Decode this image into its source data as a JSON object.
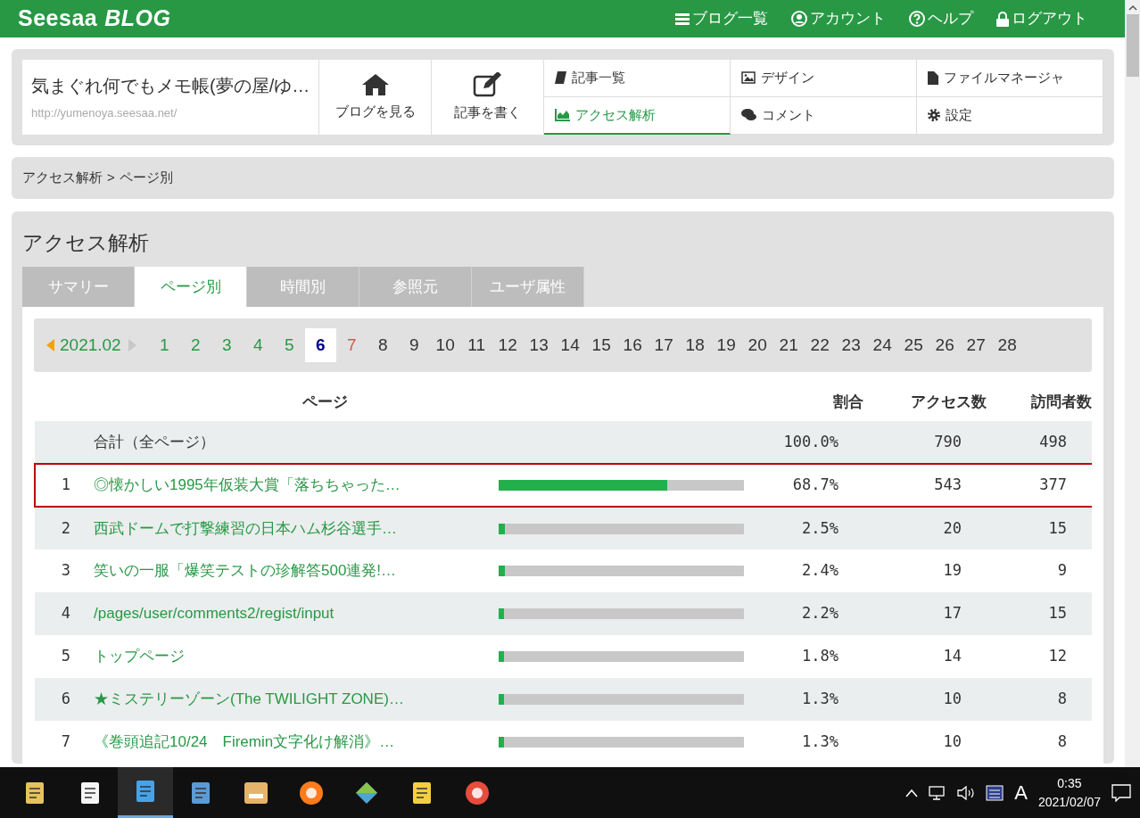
{
  "header": {
    "logo_text": "Seesaa",
    "logo_suffix": "BLOG",
    "menu": [
      {
        "label": "ブログ一覧"
      },
      {
        "label": "アカウント"
      },
      {
        "label": "ヘルプ"
      },
      {
        "label": "ログアウト"
      }
    ]
  },
  "blog": {
    "title": "気まぐれ何でもメモ帳(夢の屋/ゆ…",
    "url": "http://yumenoya.seesaa.net/"
  },
  "big_actions": [
    {
      "label": "ブログを見る"
    },
    {
      "label": "記事を書く"
    }
  ],
  "nav": [
    {
      "label": "記事一覧",
      "selected": false
    },
    {
      "label": "デザイン",
      "selected": false
    },
    {
      "label": "ファイルマネージャ",
      "selected": false
    },
    {
      "label": "アクセス解析",
      "selected": true
    },
    {
      "label": "コメント",
      "selected": false
    },
    {
      "label": "設定",
      "selected": false
    }
  ],
  "breadcrumb": [
    "アクセス解析",
    "ページ別"
  ],
  "breadcrumb_separator": ">",
  "section_title": "アクセス解析",
  "tabs": [
    {
      "label": "サマリー",
      "selected": false
    },
    {
      "label": "ページ別",
      "selected": true
    },
    {
      "label": "時間別",
      "selected": false
    },
    {
      "label": "参照元",
      "selected": false
    },
    {
      "label": "ユーザ属性",
      "selected": false
    }
  ],
  "month": "2021.02",
  "days": [
    {
      "label": "1",
      "kind": "past",
      "selected": false
    },
    {
      "label": "2",
      "kind": "past",
      "selected": false
    },
    {
      "label": "3",
      "kind": "past",
      "selected": false
    },
    {
      "label": "4",
      "kind": "past",
      "selected": false
    },
    {
      "label": "5",
      "kind": "past",
      "selected": false
    },
    {
      "label": "6",
      "kind": "past",
      "selected": true
    },
    {
      "label": "7",
      "kind": "holiday",
      "selected": false
    },
    {
      "label": "8",
      "kind": "future",
      "selected": false
    },
    {
      "label": "9",
      "kind": "future",
      "selected": false
    },
    {
      "label": "10",
      "kind": "future",
      "selected": false
    },
    {
      "label": "11",
      "kind": "future",
      "selected": false
    },
    {
      "label": "12",
      "kind": "future",
      "selected": false
    },
    {
      "label": "13",
      "kind": "future",
      "selected": false
    },
    {
      "label": "14",
      "kind": "future",
      "selected": false
    },
    {
      "label": "15",
      "kind": "future",
      "selected": false
    },
    {
      "label": "16",
      "kind": "future",
      "selected": false
    },
    {
      "label": "17",
      "kind": "future",
      "selected": false
    },
    {
      "label": "18",
      "kind": "future",
      "selected": false
    },
    {
      "label": "19",
      "kind": "future",
      "selected": false
    },
    {
      "label": "20",
      "kind": "future",
      "selected": false
    },
    {
      "label": "21",
      "kind": "future",
      "selected": false
    },
    {
      "label": "22",
      "kind": "future",
      "selected": false
    },
    {
      "label": "23",
      "kind": "future",
      "selected": false
    },
    {
      "label": "24",
      "kind": "future",
      "selected": false
    },
    {
      "label": "25",
      "kind": "future",
      "selected": false
    },
    {
      "label": "26",
      "kind": "future",
      "selected": false
    },
    {
      "label": "27",
      "kind": "future",
      "selected": false
    },
    {
      "label": "28",
      "kind": "future",
      "selected": false
    }
  ],
  "table": {
    "columns": [
      "ページ",
      "割合",
      "アクセス数",
      "訪問者数"
    ],
    "total": {
      "label": "合計（全ページ）",
      "share": "100.0%",
      "access": "790",
      "visitors": "498"
    },
    "rows": [
      {
        "rank": "1",
        "page": "◎懐かしい1995年仮装大賞「落ちちゃった…",
        "level": 0.687,
        "share": "68.7%",
        "access": "543",
        "visitors": "377",
        "highlighted": true
      },
      {
        "rank": "2",
        "page": "西武ドームで打撃練習の日本ハム杉谷選手…",
        "level": 0.025,
        "share": "2.5%",
        "access": "20",
        "visitors": "15",
        "highlighted": false
      },
      {
        "rank": "3",
        "page": "笑いの一服「爆笑テストの珍解答500連発!…",
        "level": 0.024,
        "share": "2.4%",
        "access": "19",
        "visitors": "9",
        "highlighted": false
      },
      {
        "rank": "4",
        "page": "/pages/user/comments2/regist/input",
        "level": 0.022,
        "share": "2.2%",
        "access": "17",
        "visitors": "15",
        "highlighted": false
      },
      {
        "rank": "5",
        "page": "トップページ",
        "level": 0.018,
        "share": "1.8%",
        "access": "14",
        "visitors": "12",
        "highlighted": false
      },
      {
        "rank": "6",
        "page": "★ミステリーゾーン(The TWILIGHT ZONE)…",
        "level": 0.013,
        "share": "1.3%",
        "access": "10",
        "visitors": "8",
        "highlighted": false
      },
      {
        "rank": "7",
        "page": "《巻頭追記10/24　Firemin文字化け解消》…",
        "level": 0.013,
        "share": "1.3%",
        "access": "10",
        "visitors": "8",
        "highlighted": false
      }
    ]
  },
  "taskbar": {
    "apps": [
      {
        "active": false
      },
      {
        "active": false
      },
      {
        "active": true
      },
      {
        "active": false
      },
      {
        "active": false
      },
      {
        "active": false
      },
      {
        "active": false
      },
      {
        "active": false
      },
      {
        "active": false
      }
    ],
    "ime": "A",
    "time": "0:35",
    "date": "2021/02/07"
  }
}
